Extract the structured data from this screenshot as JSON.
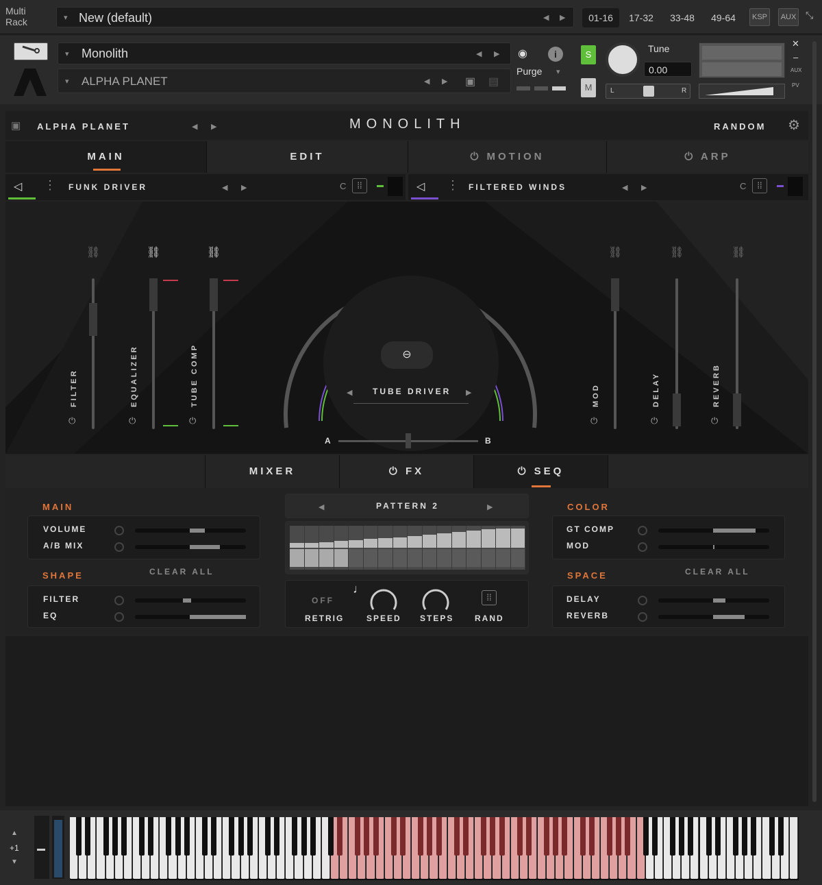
{
  "topbar": {
    "multi_rack": "Multi\nRack",
    "preset": "New (default)",
    "ranges": [
      "01-16",
      "17-32",
      "33-48",
      "49-64"
    ],
    "ksp": "KSP",
    "aux": "AUX"
  },
  "instrument": {
    "name": "Monolith",
    "sub": "ALPHA PLANET",
    "purge": "Purge",
    "tune_label": "Tune",
    "tune_value": "0.00",
    "s": "S",
    "m": "M",
    "pan_l": "L",
    "pan_r": "R",
    "aux_label": "AUX",
    "pv_label": "PV"
  },
  "header": {
    "preset": "ALPHA PLANET",
    "title": "MONOLITH",
    "random": "RANDOM"
  },
  "tabs": [
    "MAIN",
    "EDIT",
    "MOTION",
    "ARP"
  ],
  "engines": {
    "a": "FUNK DRIVER",
    "b": "FILTERED WINDS",
    "c": "C"
  },
  "sliders_left": [
    "FILTER",
    "EQUALIZER",
    "TUBE COMP"
  ],
  "sliders_right": [
    "MOD",
    "DELAY",
    "REVERB"
  ],
  "center": {
    "effect": "TUBE DRIVER",
    "a": "A",
    "b": "B"
  },
  "subtabs": [
    "MIXER",
    "FX",
    "SEQ"
  ],
  "left_panel": {
    "main": "MAIN",
    "volume": "VOLUME",
    "ab_mix": "A/B MIX",
    "shape": "SHAPE",
    "clear_all": "CLEAR ALL",
    "filter": "FILTER",
    "eq": "EQ"
  },
  "seq": {
    "pattern": "PATTERN 2",
    "off": "OFF",
    "retrig": "RETRIG",
    "speed": "SPEED",
    "steps": "STEPS",
    "rand": "RAND",
    "steps_values": [
      0.25,
      0.25,
      0.3,
      0.35,
      0.4,
      0.45,
      0.5,
      0.55,
      0.62,
      0.68,
      0.75,
      0.82,
      0.9,
      0.95,
      1.0,
      1.0
    ]
  },
  "right_panel": {
    "color": "COLOR",
    "gt_comp": "GT COMP",
    "mod": "MOD",
    "space": "SPACE",
    "clear_all": "CLEAR ALL",
    "delay": "DELAY",
    "reverb": "REVERB"
  },
  "keyboard": {
    "octave": "+1"
  },
  "colors": {
    "accent": "#e0763a",
    "green": "#5fbf3a",
    "purple": "#7a4fd0"
  }
}
